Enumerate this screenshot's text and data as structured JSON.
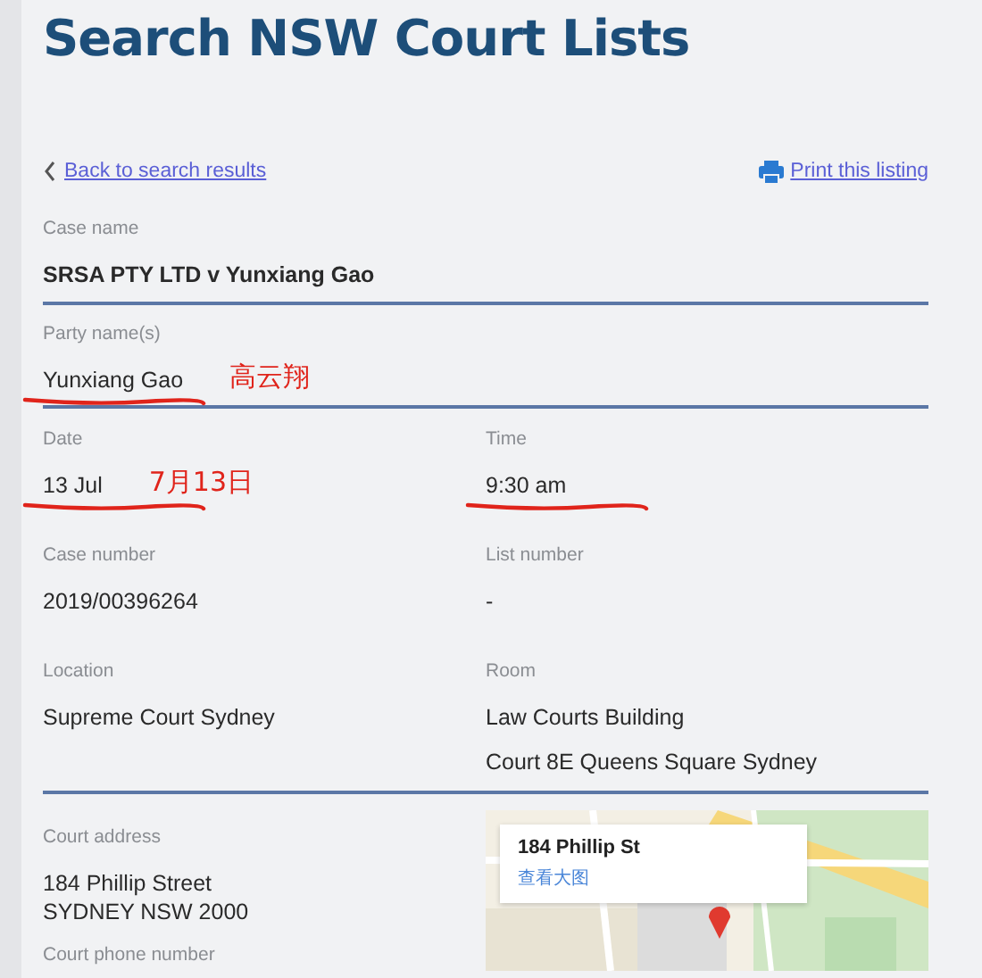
{
  "title": "Search NSW Court Lists",
  "links": {
    "back": "Back to search results",
    "print": "Print this listing"
  },
  "sections": [
    {
      "rows": [
        [
          {
            "label": "Case name",
            "values": [
              "SRSA PTY LTD v Yunxiang Gao"
            ],
            "bold": true,
            "underlined": false
          }
        ]
      ]
    },
    {
      "rows": [
        [
          {
            "label": "Party name(s)",
            "values": [
              "Yunxiang Gao"
            ],
            "bold": false,
            "underlined": true,
            "annotation": "高云翔"
          }
        ]
      ]
    },
    {
      "rows": [
        [
          {
            "label": "Date",
            "values": [
              "13 Jul"
            ],
            "bold": false,
            "underlined": true,
            "annotation": "7月13日"
          },
          {
            "label": "Time",
            "values": [
              "9:30 am"
            ],
            "bold": false,
            "underlined": true
          }
        ],
        [
          {
            "label": "Case number",
            "values": [
              "2019/00396264"
            ],
            "bold": false,
            "underlined": false
          },
          {
            "label": "List number",
            "values": [
              "-"
            ],
            "bold": false,
            "underlined": false
          }
        ],
        [
          {
            "label": "Location",
            "values": [
              "Supreme Court Sydney"
            ],
            "bold": false,
            "underlined": false
          },
          {
            "label": "Room",
            "values": [
              "Law Courts Building",
              "Court 8E Queens Square Sydney"
            ],
            "bold": false,
            "underlined": false
          }
        ]
      ]
    }
  ],
  "address": {
    "label": "Court address",
    "lines": [
      "184 Phillip Street",
      "SYDNEY NSW 2000"
    ],
    "phone_label": "Court phone number"
  },
  "map": {
    "kind": "picture",
    "popup_title": "184 Phillip St",
    "popup_link": "查看大图"
  }
}
